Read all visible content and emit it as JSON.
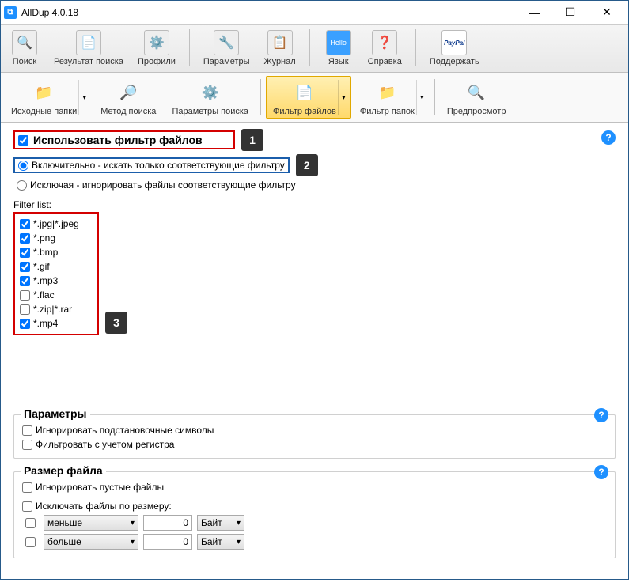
{
  "title": "AllDup 4.0.18",
  "win_buttons": {
    "min": "—",
    "max": "☐",
    "close": "✕"
  },
  "main_toolbar": [
    {
      "key": "search",
      "label": "Поиск",
      "icon": "🔍"
    },
    {
      "key": "results",
      "label": "Результат поиска",
      "icon": "📄"
    },
    {
      "key": "profiles",
      "label": "Профили",
      "icon": "⚙️"
    },
    {
      "sep": true
    },
    {
      "key": "params",
      "label": "Параметры",
      "icon": "🔧"
    },
    {
      "key": "log",
      "label": "Журнал",
      "icon": "📋"
    },
    {
      "sep": true
    },
    {
      "key": "lang",
      "label": "Язык",
      "icon": "Hello"
    },
    {
      "key": "help",
      "label": "Справка",
      "icon": "❓"
    },
    {
      "sep": true
    },
    {
      "key": "support",
      "label": "Поддержать",
      "icon": "PayPal"
    }
  ],
  "sub_toolbar": [
    {
      "key": "src-folders",
      "label": "Исходные папки",
      "icon": "📁",
      "dd": true
    },
    {
      "key": "method",
      "label": "Метод поиска",
      "icon": "🔎"
    },
    {
      "key": "search-params",
      "label": "Параметры поиска",
      "icon": "⚙️"
    },
    {
      "sep": true
    },
    {
      "key": "file-filter",
      "label": "Фильтр файлов",
      "icon": "📄",
      "active": true,
      "dd": true
    },
    {
      "key": "folder-filter",
      "label": "Фильтр папок",
      "icon": "📁",
      "dd": true
    },
    {
      "sep": true
    },
    {
      "key": "preview",
      "label": "Предпросмотр",
      "icon": "🔍"
    }
  ],
  "use_filter": {
    "label": "Использовать фильтр файлов",
    "checked": true
  },
  "callouts": {
    "c1": "1",
    "c2": "2",
    "c3": "3"
  },
  "mode": {
    "inc_label": "Включительно - искать только соответствующие фильтру",
    "exc_label": "Исключая - игнорировать файлы соответствующие фильтру",
    "selected": "inc"
  },
  "filter_list": {
    "title": "Filter list:",
    "items": [
      {
        "label": "*.jpg|*.jpeg",
        "checked": true
      },
      {
        "label": "*.png",
        "checked": true
      },
      {
        "label": "*.bmp",
        "checked": true
      },
      {
        "label": "*.gif",
        "checked": true
      },
      {
        "label": "*.mp3",
        "checked": true
      },
      {
        "label": "*.flac",
        "checked": false
      },
      {
        "label": "*.zip|*.rar",
        "checked": false
      },
      {
        "label": "*.mp4",
        "checked": true
      }
    ]
  },
  "params_group": {
    "title": "Параметры",
    "opt1": {
      "label": "Игнорировать подстановочные символы",
      "checked": false
    },
    "opt2": {
      "label": "Фильтровать с учетом регистра",
      "checked": false
    }
  },
  "size_group": {
    "title": "Размер файла",
    "ignore_empty": {
      "label": "Игнорировать пустые файлы",
      "checked": false
    },
    "exclude_by_size": {
      "label": "Исключать файлы по размеру:",
      "checked": false
    },
    "rows": [
      {
        "enabled": false,
        "op": "меньше",
        "value": "0",
        "unit": "Байт"
      },
      {
        "enabled": false,
        "op": "больше",
        "value": "0",
        "unit": "Байт"
      }
    ]
  },
  "help_badge": "?"
}
